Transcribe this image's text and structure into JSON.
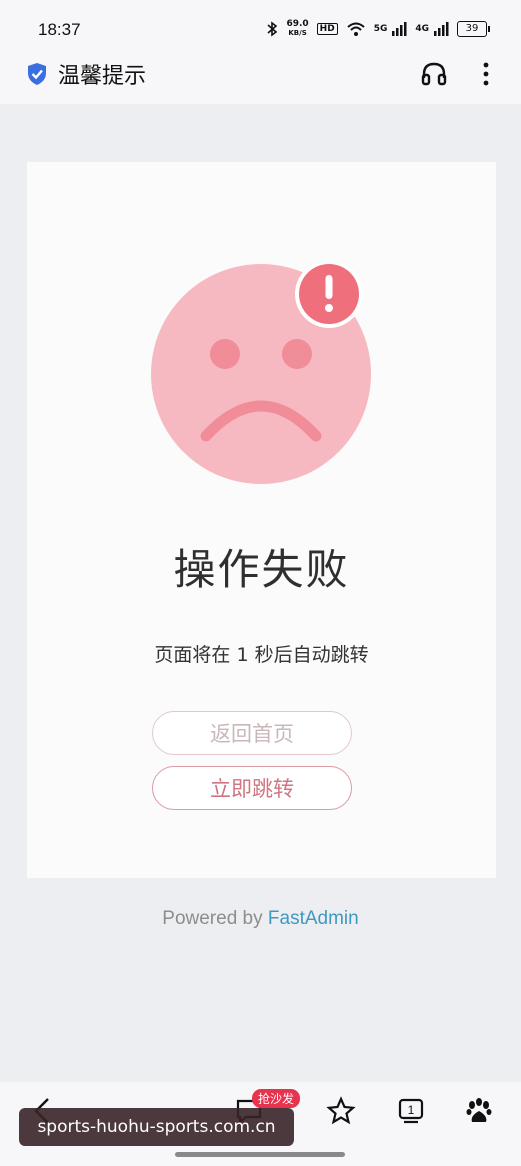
{
  "status_bar": {
    "time": "18:37",
    "speed_value": "69.0",
    "speed_unit": "KB/S",
    "hd_label": "HD",
    "net1": "5G",
    "net2": "4G",
    "battery": "39"
  },
  "app_bar": {
    "title": "温馨提示",
    "icons": [
      "shield-check-icon",
      "headset-icon",
      "more-vertical-icon"
    ]
  },
  "page": {
    "heading": "操作失败",
    "message": "页面将在 1 秒后自动跳转",
    "home_button": "返回首页",
    "jump_button": "立即跳转",
    "powered_prefix": "Powered by",
    "powered_brand": "FastAdmin"
  },
  "bottom_nav": {
    "badge": "抢沙发",
    "tab_count": "1",
    "icons": [
      "back-icon",
      "comment-icon",
      "star-icon",
      "tabs-icon",
      "baidu-paw-icon"
    ]
  },
  "watermark": "sports-huohu-sports.com.cn",
  "colors": {
    "face": "#f7b9c1",
    "face_features": "#f08d98",
    "alert_badge": "#ef6f7c",
    "brand_link": "#3f98c2"
  }
}
